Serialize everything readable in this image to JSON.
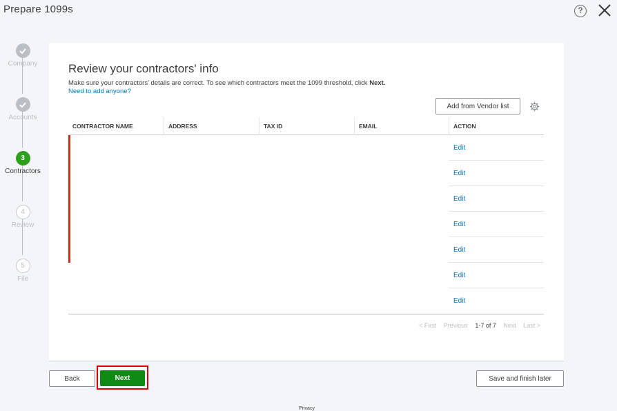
{
  "header": {
    "title": "Prepare 1099s",
    "help_label": "?"
  },
  "stepper": [
    {
      "label": "Company",
      "state": "done",
      "number": ""
    },
    {
      "label": "Accounts",
      "state": "done",
      "number": ""
    },
    {
      "label": "Contractors",
      "state": "active",
      "number": "3"
    },
    {
      "label": "Review",
      "state": "todo",
      "number": "4"
    },
    {
      "label": "File",
      "state": "todo",
      "number": "5"
    }
  ],
  "main": {
    "heading": "Review your contractors' info",
    "subtext_before": "Make sure your contractors' details are correct. To see which contractors meet the 1099 threshold, click ",
    "subtext_bold": "Next.",
    "link": "Need to add anyone?",
    "vendor_button": "Add from Vendor list"
  },
  "table": {
    "columns": [
      "CONTRACTOR NAME",
      "ADDRESS",
      "TAX ID",
      "EMAIL",
      "ACTION"
    ],
    "rows": [
      {
        "action": "Edit",
        "flagged": true
      },
      {
        "action": "Edit",
        "flagged": true
      },
      {
        "action": "Edit",
        "flagged": true
      },
      {
        "action": "Edit",
        "flagged": true
      },
      {
        "action": "Edit",
        "flagged": true
      },
      {
        "action": "Edit",
        "flagged": false
      },
      {
        "action": "Edit",
        "flagged": false
      }
    ]
  },
  "pager": {
    "first": "< First",
    "previous": "Previous",
    "count": "1-7 of 7",
    "next": "Next",
    "last": "Last >"
  },
  "footer": {
    "back": "Back",
    "next": "Next",
    "save": "Save and finish later",
    "privacy": "Privacy"
  },
  "colors": {
    "accent": "#2ca01c",
    "next_button": "#0e8a14",
    "link": "#0077c5",
    "flag": "#d52b1e",
    "highlight": "#e00000"
  }
}
